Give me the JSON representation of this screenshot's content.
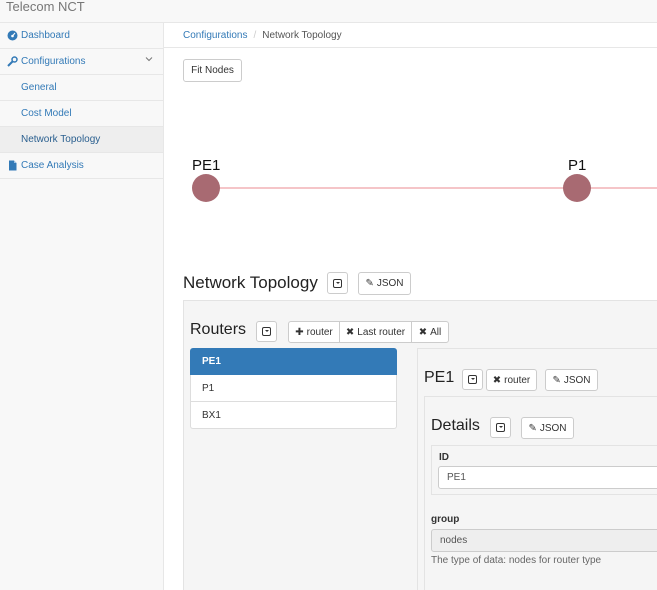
{
  "app": {
    "title": "Telecom NCT"
  },
  "sidebar": {
    "items": [
      {
        "label": "Dashboard",
        "icon": "dashboard-icon"
      },
      {
        "label": "Configurations",
        "icon": "wrench-icon"
      },
      {
        "label": "General"
      },
      {
        "label": "Cost Model"
      },
      {
        "label": "Network Topology"
      },
      {
        "label": "Case Analysis",
        "icon": "file-icon"
      }
    ]
  },
  "breadcrumb": {
    "parent": "Configurations",
    "separator": "/",
    "current": "Network Topology"
  },
  "toolbar": {
    "fit_nodes": "Fit Nodes"
  },
  "graph": {
    "nodes": [
      "PE1",
      "P1"
    ],
    "node_color": "#a86a72",
    "edge_color": "#f5c5c8"
  },
  "topology": {
    "title": "Network Topology",
    "json_label": "JSON"
  },
  "routers": {
    "title": "Routers",
    "add_label": "router",
    "remove_last_label": "Last router",
    "remove_all_label": "All",
    "items": [
      "PE1",
      "P1",
      "BX1"
    ],
    "selected": "PE1"
  },
  "router_detail": {
    "title": "PE1",
    "remove_label": "router",
    "json_label": "JSON",
    "details": {
      "title": "Details",
      "json_label": "JSON",
      "id_label": "ID",
      "id_value": "PE1",
      "group_label": "group",
      "group_value": "nodes",
      "group_help": "The type of data: nodes for router type"
    }
  },
  "colors": {
    "accent": "#337ab7",
    "link": "#337ab7"
  }
}
